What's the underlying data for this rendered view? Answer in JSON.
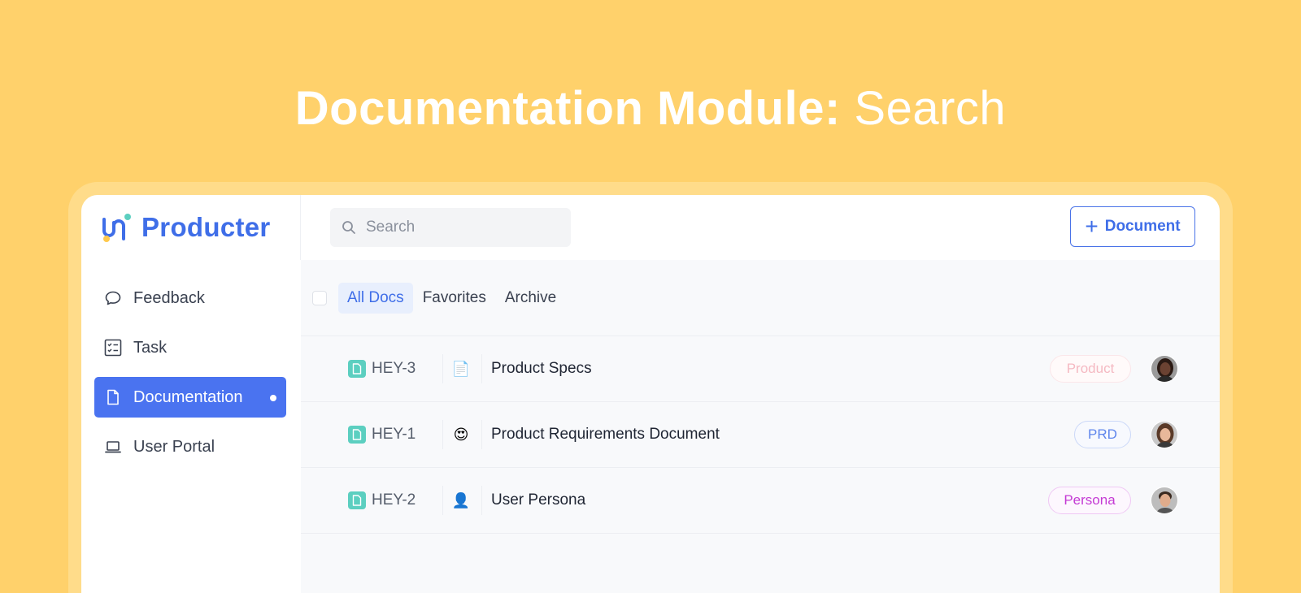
{
  "headline": {
    "bold": "Documentation Module:",
    "light": "Search"
  },
  "brand": {
    "name": "Producter",
    "logo_icon": "producter-logo-icon"
  },
  "search": {
    "placeholder": "Search",
    "icon": "search-icon"
  },
  "header": {
    "new_document_plus": "+",
    "new_document_label": "Document"
  },
  "sidebar": {
    "items": [
      {
        "label": "Feedback",
        "icon": "chat-bubble-icon",
        "active": false
      },
      {
        "label": "Task",
        "icon": "checklist-icon",
        "active": false
      },
      {
        "label": "Documentation",
        "icon": "document-icon",
        "active": true
      },
      {
        "label": "User Portal",
        "icon": "laptop-icon",
        "active": false
      }
    ]
  },
  "tabs": [
    {
      "label": "All Docs",
      "active": true
    },
    {
      "label": "Favorites",
      "active": false
    },
    {
      "label": "Archive",
      "active": false
    }
  ],
  "documents": [
    {
      "id": "HEY-3",
      "emoji": "📄",
      "title": "Product Specs",
      "tag": "Product"
    },
    {
      "id": "HEY-1",
      "emoji": "😍",
      "title": "Product Requirements Document",
      "tag": "PRD"
    },
    {
      "id": "HEY-2",
      "emoji": "👤",
      "title": "User Persona",
      "tag": "Persona"
    }
  ],
  "colors": {
    "background": "#ffd16b",
    "accent": "#3f6ee8",
    "active_nav": "#4a73f0",
    "doc_icon": "#5ccfc0",
    "tag_product": "#f5b9c2",
    "tag_prd": "#5f86ec",
    "tag_persona": "#c43ad4"
  }
}
